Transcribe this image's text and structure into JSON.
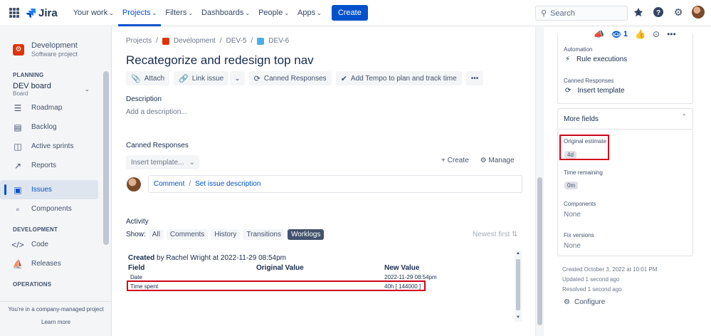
{
  "topnav": {
    "logo": "Jira",
    "items": [
      {
        "label": "Your work",
        "active": false
      },
      {
        "label": "Projects",
        "active": true
      },
      {
        "label": "Filters",
        "active": false
      },
      {
        "label": "Dashboards",
        "active": false
      },
      {
        "label": "People",
        "active": false
      },
      {
        "label": "Apps",
        "active": false
      }
    ],
    "create_label": "Create",
    "search_placeholder": "Search"
  },
  "sidebar": {
    "project_name": "Development",
    "project_type": "Software project",
    "planning_title": "PLANNING",
    "board_name": "DEV board",
    "board_sub": "Board",
    "planning_items": [
      "Roadmap",
      "Backlog",
      "Active sprints",
      "Reports"
    ],
    "issues_label": "Issues",
    "components_label": "Components",
    "development_title": "DEVELOPMENT",
    "dev_items": [
      "Code",
      "Releases"
    ],
    "operations_title": "OPERATIONS",
    "footer_text": "You're in a company-managed project",
    "learn_more": "Learn more"
  },
  "issue": {
    "breadcrumbs": [
      "Projects",
      "Development",
      "DEV-5",
      "DEV-6"
    ],
    "title": "Recategorize and redesign top nav",
    "toolbar": {
      "attach": "Attach",
      "link_issue": "Link issue",
      "canned_responses": "Canned Responses",
      "tempo": "Add Tempo to plan and track time"
    },
    "description_label": "Description",
    "description_placeholder": "Add a description...",
    "canned_label": "Canned Responses",
    "canned_select": "Insert template...",
    "create_label": "Create",
    "manage_label": "Manage",
    "comment_link": "Comment",
    "comment_sep": "/",
    "set_desc_link": "Set issue description",
    "activity_label": "Activity",
    "show_label": "Show:",
    "filters": [
      {
        "label": "All",
        "active": false
      },
      {
        "label": "Comments",
        "active": false
      },
      {
        "label": "History",
        "active": false
      },
      {
        "label": "Transitions",
        "active": false
      },
      {
        "label": "Worklogs",
        "active": true
      }
    ],
    "newest_first": "Newest first"
  },
  "worklog": {
    "created_label": "Created",
    "created_rest": " by Rachel Wright at 2022-11-29 08:54pm",
    "columns": [
      "Field",
      "Original Value",
      "New Value"
    ],
    "rows": [
      {
        "field": "Date",
        "original": "",
        "new": "2022-11-29 08:54pm"
      },
      {
        "field": "Time spent",
        "original": "",
        "new": "40h [ 144000 ]"
      }
    ]
  },
  "right": {
    "watch_count": "1",
    "automation_label": "Automation",
    "automation_value": "Rule executions",
    "canned_label": "Canned Responses",
    "canned_value": "Insert template",
    "more_fields": "More fields",
    "original_estimate_label": "Original estimate",
    "original_estimate": "4d",
    "time_remaining_label": "Time remaining",
    "time_remaining": "0m",
    "components_label": "Components",
    "components_value": "None",
    "fix_versions_label": "Fix versions",
    "fix_versions_value": "None",
    "created": "Created October 3, 2022 at 10:01 PM",
    "updated": "Updated 1 second ago",
    "resolved": "Resolved 1 second ago",
    "configure": "Configure"
  },
  "colors": {
    "brand": "#0052cc",
    "highlight": "#d0021b",
    "project_icon": "#de350b"
  }
}
